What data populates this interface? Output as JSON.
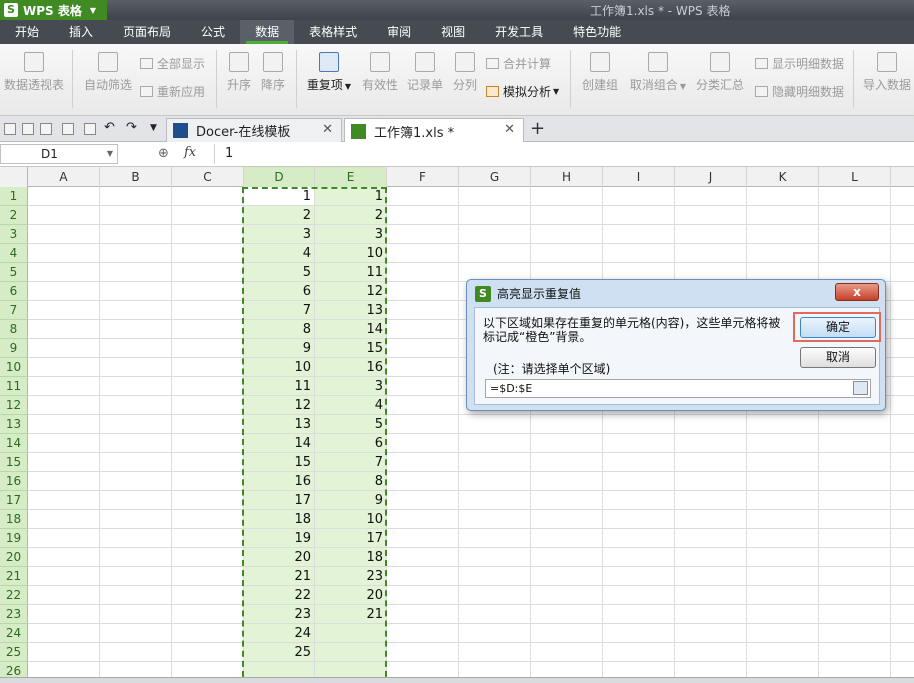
{
  "app": {
    "menu_label": "WPS 表格",
    "window_title": "工作簿1.xls * - WPS 表格"
  },
  "menu_tabs": [
    "开始",
    "插入",
    "页面布局",
    "公式",
    "数据",
    "表格样式",
    "审阅",
    "视图",
    "开发工具",
    "特色功能"
  ],
  "active_menu_tab": "数据",
  "ribbon": {
    "pivot": "数据透视表",
    "autofilter": "自动筛选",
    "show_all": "全部显示",
    "reapply": "重新应用",
    "sort_asc": "升序",
    "sort_desc": "降序",
    "duplicates": "重复项",
    "validity": "有效性",
    "record": "记录单",
    "split": "分列",
    "consolidate": "合并计算",
    "what_if": "模拟分析",
    "group": "创建组",
    "ungroup": "取消组合",
    "subtotal": "分类汇总",
    "show_detail": "显示明细数据",
    "hide_detail": "隐藏明细数据",
    "import": "导入数据"
  },
  "doc_tabs": [
    {
      "label": "Docer-在线模板",
      "active": false
    },
    {
      "label": "工作簿1.xls *",
      "active": true
    }
  ],
  "formula_bar": {
    "name_box": "D1",
    "fx": "fx",
    "value": "1"
  },
  "columns": [
    "A",
    "B",
    "C",
    "D",
    "E",
    "F",
    "G",
    "H",
    "I",
    "J",
    "K",
    "L"
  ],
  "rows": [
    "1",
    "2",
    "3",
    "4",
    "5",
    "6",
    "7",
    "8",
    "9",
    "10",
    "11",
    "12",
    "13",
    "14",
    "15",
    "16",
    "17",
    "18",
    "19",
    "20",
    "21",
    "22",
    "23",
    "24",
    "25",
    "26"
  ],
  "column_d": [
    "1",
    "2",
    "3",
    "4",
    "5",
    "6",
    "7",
    "8",
    "9",
    "10",
    "11",
    "12",
    "13",
    "14",
    "15",
    "16",
    "17",
    "18",
    "19",
    "20",
    "21",
    "22",
    "23",
    "24",
    "25"
  ],
  "column_e": [
    "1",
    "2",
    "3",
    "10",
    "11",
    "12",
    "13",
    "14",
    "15",
    "16",
    "3",
    "4",
    "5",
    "6",
    "7",
    "8",
    "9",
    "10",
    "17",
    "18",
    "23",
    "20",
    "21"
  ],
  "dialog": {
    "title": "高亮显示重复值",
    "close": "x",
    "message": "以下区域如果存在重复的单元格(内容)，这些单元格将被标记成“橙色”背景。",
    "note": "(注：请选择单个区域)",
    "range": "=$D:$E",
    "ok_label": "确定",
    "cancel_label": "取消"
  },
  "colors": {
    "accent_green": "#3f8a23",
    "selection_fill": "#e3f3d6",
    "highlight_red": "#e06a5e"
  }
}
